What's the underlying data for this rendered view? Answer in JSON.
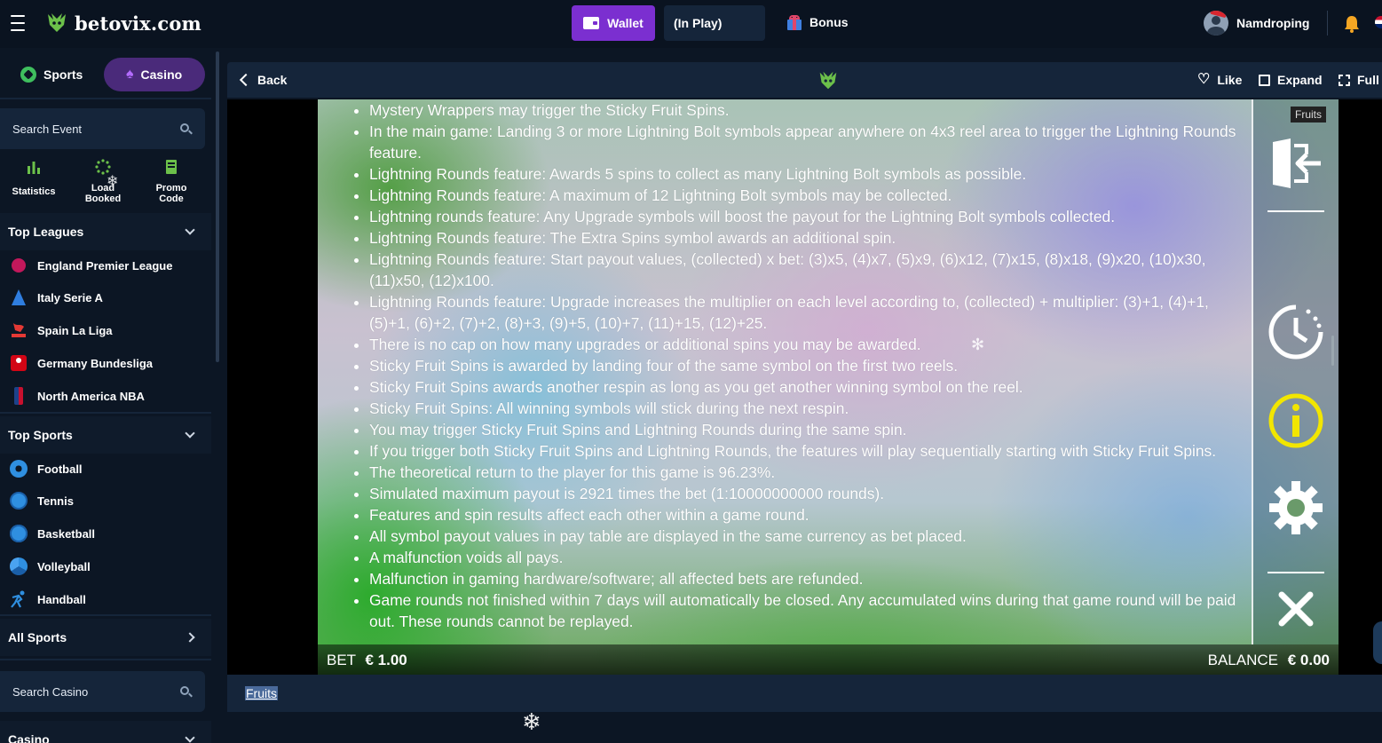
{
  "header": {
    "logo_text": "betovix.com",
    "wallet_label": "Wallet",
    "inplay_label": "(In Play)",
    "bonus_label": "Bonus",
    "username": "Namdroping"
  },
  "sidebar": {
    "tabs": {
      "sports": "Sports",
      "casino": "Casino"
    },
    "search_event_placeholder": "Search Event",
    "quick": {
      "statistics": "Statistics",
      "load_booked_1": "Load",
      "load_booked_2": "Booked",
      "promo_1": "Promo",
      "promo_2": "Code"
    },
    "top_leagues_title": "Top Leagues",
    "leagues": [
      "England Premier League",
      "Italy Serie A",
      "Spain La Liga",
      "Germany Bundesliga",
      "North America NBA"
    ],
    "top_sports_title": "Top Sports",
    "sports": [
      "Football",
      "Tennis",
      "Basketball",
      "Volleyball",
      "Handball"
    ],
    "all_sports": "All Sports",
    "search_casino_placeholder": "Search Casino",
    "casino_title": "Casino"
  },
  "game_header": {
    "back": "Back",
    "like": "Like",
    "expand": "Expand",
    "full": "Full"
  },
  "game": {
    "tag": "Fruits",
    "rules": [
      "Mystery Wrappers may trigger the Sticky Fruit Spins.",
      "In the main game: Landing 3 or more Lightning Bolt symbols appear anywhere on 4x3 reel area to trigger the Lightning Rounds feature.",
      "Lightning Rounds feature: Awards 5 spins to collect as many Lightning Bolt symbols as possible.",
      "Lightning Rounds feature: A maximum of 12 Lightning Bolt symbols may be collected.",
      "Lightning rounds feature: Any Upgrade symbols will boost the payout for the Lightning Bolt symbols collected.",
      "Lightning Rounds feature: The Extra Spins symbol awards an additional spin.",
      "Lightning Rounds feature: Start payout values, (collected) x bet: (3)x5, (4)x7, (5)x9, (6)x12, (7)x15, (8)x18, (9)x20, (10)x30, (11)x50, (12)x100.",
      "Lightning Rounds feature: Upgrade increases the multiplier on each level according to, (collected) + multiplier: (3)+1, (4)+1, (5)+1, (6)+2, (7)+2, (8)+3, (9)+5, (10)+7, (11)+15, (12)+25.",
      "There is no cap on how many upgrades or additional spins you may be awarded.",
      "Sticky Fruit Spins is awarded by landing four of the same symbol on the first two reels.",
      "Sticky Fruit Spins awards another respin as long as you get another winning symbol on the reel.",
      "Sticky Fruit Spins: All winning symbols will stick during the next respin.",
      "You may trigger Sticky Fruit Spins and Lightning Rounds during the same spin.",
      "If you trigger both Sticky Fruit Spins and Lightning Rounds, the features will play sequentially starting with Sticky Fruit Spins.",
      "The theoretical return to the player for this game is 96.23%.",
      "Simulated maximum payout is 2921 times the bet (1:10000000000 rounds).",
      "Features and spin results affect each other within a game round.",
      "All symbol payout values in pay table are displayed in the same currency as bet placed.",
      "A malfunction voids all pays.",
      "Malfunction in gaming hardware/software; all affected bets are refunded.",
      "Game rounds not finished within 7 days will automatically be closed. Any accumulated wins during that game round will be paid out. These rounds cannot be replayed."
    ],
    "bet_label": "BET",
    "bet_value": "€ 1.00",
    "balance_label": "BALANCE",
    "balance_value": "€ 0.00"
  },
  "footer": {
    "game_title": "Fruits"
  },
  "colors": {
    "accent_purple": "#7b2fd0",
    "panel": "#15253a",
    "bg": "#0c1624",
    "icon_yellow": "#f2e600"
  }
}
